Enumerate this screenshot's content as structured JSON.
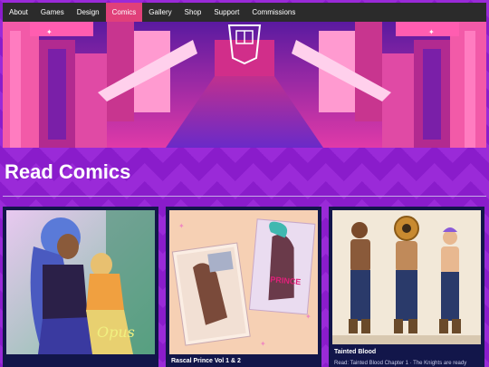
{
  "nav": {
    "items": [
      {
        "label": "About"
      },
      {
        "label": "Games"
      },
      {
        "label": "Design"
      },
      {
        "label": "Comics"
      },
      {
        "label": "Gallery"
      },
      {
        "label": "Shop"
      },
      {
        "label": "Support"
      },
      {
        "label": "Commissions"
      }
    ],
    "active_index": 3,
    "active_color": "#e0407a"
  },
  "page": {
    "title": "Read Comics"
  },
  "cards": [
    {
      "title": "",
      "image": "comic-cover-opus-illustration"
    },
    {
      "title": "Rascal Prince Vol 1 & 2",
      "image": "comic-cover-rascal-prince"
    },
    {
      "title": "Tainted Blood",
      "image": "comic-character-lineup",
      "description": "Read: Tainted Blood Chapter 1 · The Knights are ready"
    }
  ],
  "colors": {
    "background": "#8a1ccb",
    "nav_bg": "#2b2b2b",
    "card_bg": "#12164a"
  }
}
